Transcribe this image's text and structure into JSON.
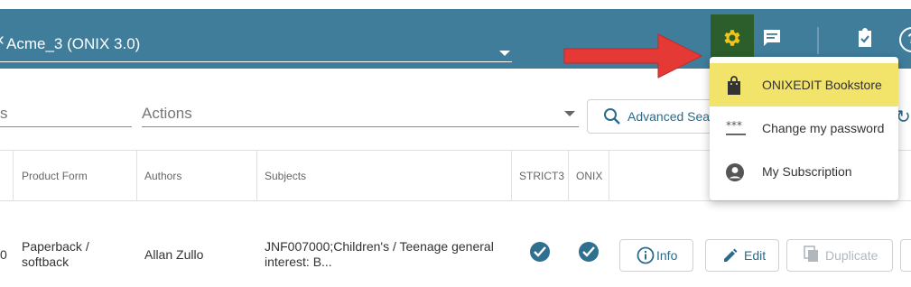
{
  "header": {
    "catalog_label": "Acme_3 (ONIX 3.0)",
    "catalog_caret_left": "‹"
  },
  "toolbar": {
    "search_placeholder": "s",
    "actions_label": "Actions",
    "advanced_search_label": "Advanced Sear"
  },
  "settings_menu": {
    "items": [
      {
        "label": "ONIXEDIT Bookstore",
        "icon": "shopping-bag-icon",
        "active": true
      },
      {
        "label": "Change my password",
        "icon": "password-icon",
        "active": false
      },
      {
        "label": "My Subscription",
        "icon": "account-circle-icon",
        "active": false
      }
    ]
  },
  "table": {
    "headers": [
      "Product Form",
      "Authors",
      "Subjects",
      "STRICT3",
      "ONIX"
    ],
    "row": {
      "leading_fragment": "0",
      "product_form": "Paperback / softback",
      "authors": "Allan Zullo",
      "subjects": "JNF007000;Children's / Teenage general interest: B...",
      "strict3": true,
      "onix": true,
      "buttons": {
        "info": "Info",
        "edit": "Edit",
        "duplicate": "Duplicate"
      }
    }
  },
  "colors": {
    "header_bg": "#3f7d9b",
    "gear_bg": "#2b5e2b",
    "menu_highlight": "#f2e36a",
    "arrow": "#e53935",
    "check": "#2f6f90"
  }
}
